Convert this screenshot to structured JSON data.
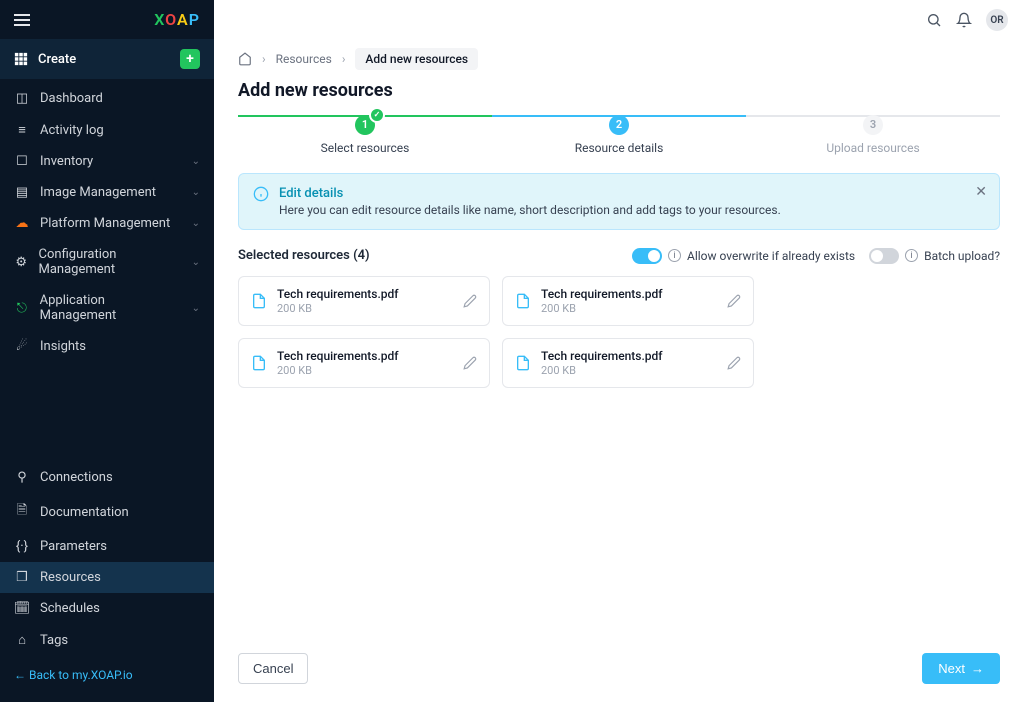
{
  "brand": "XOAP",
  "sidebar": {
    "create_label": "Create",
    "nav": [
      {
        "label": "Dashboard",
        "icon": "dashboard-icon",
        "has_children": false
      },
      {
        "label": "Activity log",
        "icon": "activity-icon",
        "has_children": false
      },
      {
        "label": "Inventory",
        "icon": "inventory-icon",
        "has_children": true
      },
      {
        "label": "Image Management",
        "icon": "image-icon",
        "has_children": true
      },
      {
        "label": "Platform Management",
        "icon": "cloud-icon",
        "has_children": true,
        "icon_color": "#f97316"
      },
      {
        "label": "Configuration Management",
        "icon": "config-icon",
        "has_children": true
      },
      {
        "label": "Application Management",
        "icon": "app-icon",
        "has_children": true,
        "icon_color": "#22c55e"
      },
      {
        "label": "Insights",
        "icon": "insights-icon",
        "has_children": false
      }
    ],
    "bottom_nav": [
      {
        "label": "Connections",
        "icon": "connections-icon"
      },
      {
        "label": "Documentation",
        "icon": "doc-icon"
      },
      {
        "label": "Parameters",
        "icon": "params-icon"
      },
      {
        "label": "Resources",
        "icon": "resources-icon",
        "active": true
      },
      {
        "label": "Schedules",
        "icon": "schedules-icon"
      },
      {
        "label": "Tags",
        "icon": "tags-icon"
      }
    ],
    "back_label": "Back to my.XOAP.io"
  },
  "topbar": {
    "avatar_initials": "OR"
  },
  "breadcrumb": {
    "resources_label": "Resources",
    "current_label": "Add new resources"
  },
  "page_title": "Add new resources",
  "stepper": [
    {
      "num": "1",
      "label": "Select resources",
      "state": "done"
    },
    {
      "num": "2",
      "label": "Resource details",
      "state": "active"
    },
    {
      "num": "3",
      "label": "Upload resources",
      "state": "pending"
    }
  ],
  "info_banner": {
    "title": "Edit details",
    "text": "Here you can edit resource details like name, short description and add tags to your resources."
  },
  "selected_resources": {
    "label": "Selected resources (4)",
    "toggles": {
      "overwrite": {
        "label": "Allow overwrite if already exists",
        "on": true
      },
      "batch": {
        "label": "Batch upload?",
        "on": false
      }
    },
    "files": [
      {
        "name": "Tech requirements.pdf",
        "size": "200 KB"
      },
      {
        "name": "Tech requirements.pdf",
        "size": "200 KB"
      },
      {
        "name": "Tech requirements.pdf",
        "size": "200 KB"
      },
      {
        "name": "Tech requirements.pdf",
        "size": "200 KB"
      }
    ]
  },
  "footer": {
    "cancel_label": "Cancel",
    "next_label": "Next"
  }
}
